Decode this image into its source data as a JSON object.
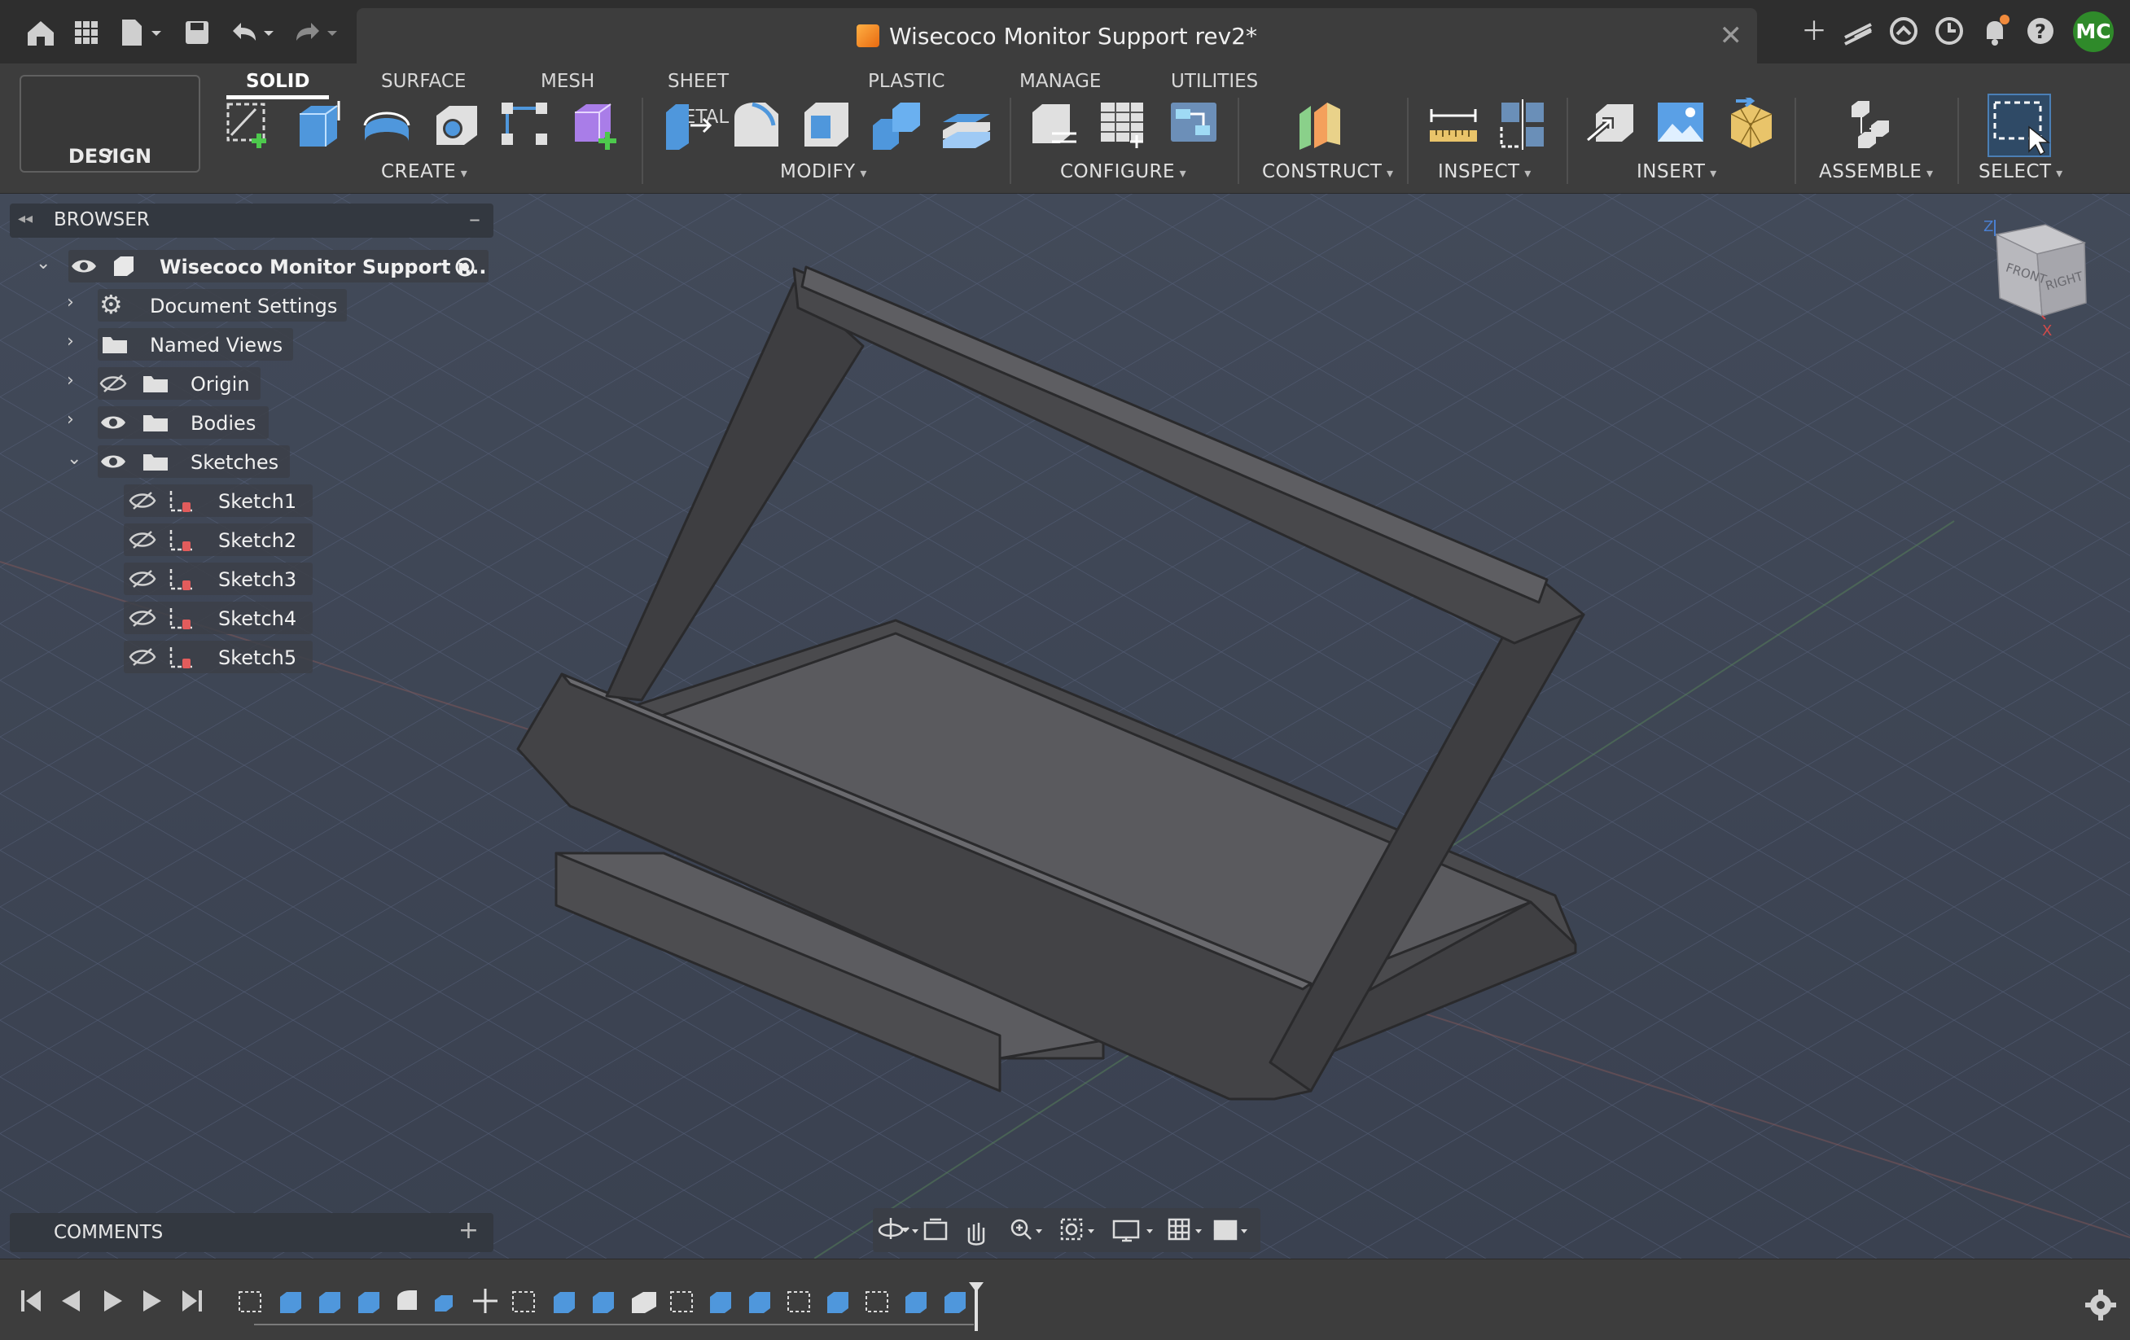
{
  "window": {
    "title": "Wisecoco Monitor Support rev2*",
    "user_initials": "MC"
  },
  "toolbar": {
    "tabs": [
      "SOLID",
      "SURFACE",
      "MESH",
      "SHEET METAL",
      "PLASTIC",
      "MANAGE",
      "UTILITIES"
    ],
    "active_tab": "SOLID",
    "workspace": "DESIGN",
    "groups": [
      "CREATE",
      "MODIFY",
      "CONFIGURE",
      "CONSTRUCT",
      "INSPECT",
      "INSERT",
      "ASSEMBLE",
      "SELECT"
    ]
  },
  "browser": {
    "title": "BROWSER",
    "root": "Wisecoco Monitor Support r...",
    "items": [
      "Document Settings",
      "Named Views",
      "Origin",
      "Bodies",
      "Sketches"
    ],
    "sketches": [
      "Sketch1",
      "Sketch2",
      "Sketch3",
      "Sketch4",
      "Sketch5"
    ]
  },
  "viewcube": {
    "front": "FRONT",
    "right": "RIGHT",
    "z_axis": "Z",
    "x_axis": "X"
  },
  "comments": {
    "title": "COMMENTS"
  },
  "colors": {
    "accent": "#5aa0e6",
    "avatar": "#2f8a2a",
    "model": "#4a4a4c"
  }
}
